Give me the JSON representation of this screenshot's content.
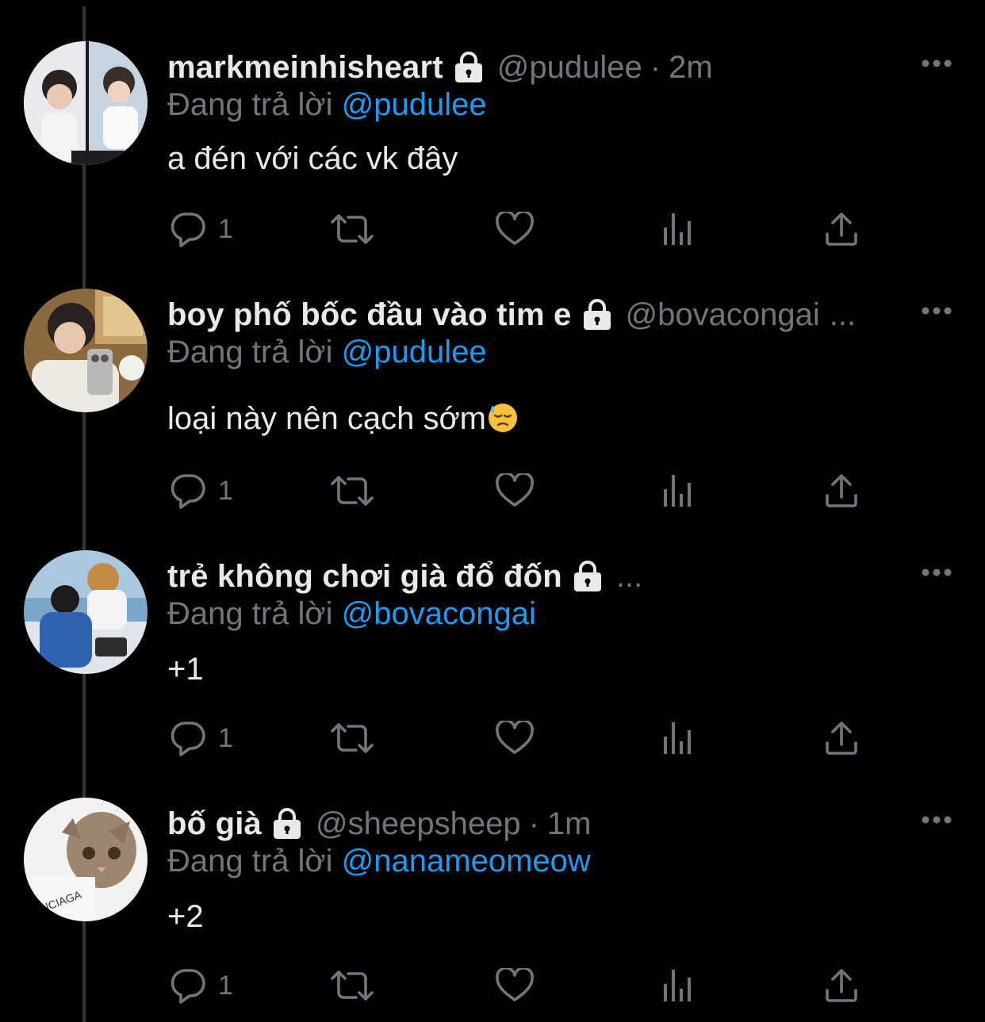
{
  "colors": {
    "background": "#000000",
    "text_primary": "#e7e9ea",
    "text_secondary": "#71767b",
    "accent": "#1d9bf0",
    "thread_line": "#333639"
  },
  "tweets": [
    {
      "display_name": "markmeinhisheart",
      "handle": "@pudulee",
      "separator": "·",
      "time": "2m",
      "reply_prefix": "Đang trả lời",
      "reply_to": "@pudulee",
      "text": "a đén với các vk đây",
      "reply_count": "1",
      "icons": [
        "lock-icon",
        "more-icon",
        "reply-icon",
        "retweet-icon",
        "like-icon",
        "views-icon",
        "share-icon"
      ]
    },
    {
      "display_name": "boy phố bốc đầu vào tim e",
      "handle": "@bovacongai",
      "truncation": "...",
      "reply_prefix": "Đang trả lời",
      "reply_to": "@pudulee",
      "text": "loại này nên cạch sớm",
      "text_emoji": "downcast-face-with-sweat-emoji",
      "reply_count": "1"
    },
    {
      "display_name": "trẻ không chơi già đổ đốn",
      "truncation": "...",
      "reply_prefix": "Đang trả lời",
      "reply_to": "@bovacongai",
      "text": "+1",
      "reply_count": "1"
    },
    {
      "display_name": "bố già",
      "handle": "@sheepsheep",
      "separator": "·",
      "time": "1m",
      "reply_prefix": "Đang trả lời",
      "reply_to": "@nanameomeow",
      "text": "+2",
      "reply_count": "1"
    }
  ]
}
